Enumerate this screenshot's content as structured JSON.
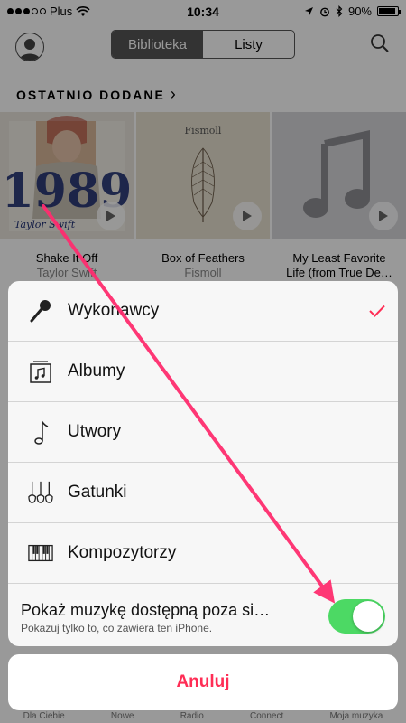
{
  "status": {
    "carrier": "Plus",
    "time": "10:34",
    "battery": "90%",
    "battery_level": 0.9
  },
  "nav": {
    "segments": [
      "Biblioteka",
      "Listy"
    ],
    "active_segment": "Biblioteka"
  },
  "section": {
    "title": "OSTATNIO DODANE",
    "chevron": "›"
  },
  "albums": [
    {
      "title": "Shake It Off",
      "artist": "Taylor Swift",
      "cover_text": "1989",
      "cover_signature": "Taylor Swift"
    },
    {
      "title": "Box of Feathers",
      "artist": "Fismoll",
      "cover_text": "Fismoll"
    },
    {
      "title": "My Least Favorite",
      "title2": "Life (from True De…",
      "artist": ""
    }
  ],
  "sheet": {
    "items": [
      {
        "label": "Wykonawcy",
        "icon": "microphone-icon",
        "selected": true
      },
      {
        "label": "Albumy",
        "icon": "album-icon",
        "selected": false
      },
      {
        "label": "Utwory",
        "icon": "music-note-icon",
        "selected": false
      },
      {
        "label": "Gatunki",
        "icon": "guitars-icon",
        "selected": false
      },
      {
        "label": "Kompozytorzy",
        "icon": "piano-keys-icon",
        "selected": false
      }
    ],
    "toggle": {
      "title": "Pokaż muzykę dostępną poza si…",
      "subtitle": "Pokazuj tylko to, co zawiera ten iPhone.",
      "on": true
    },
    "cancel_label": "Anuluj"
  },
  "tabbar": [
    "Dla Ciebie",
    "Nowe",
    "Radio",
    "Connect",
    "Moja muzyka"
  ],
  "colors": {
    "accent": "#ff2d55",
    "toggle_on": "#4cd964",
    "arrow": "#ff2d6f"
  }
}
